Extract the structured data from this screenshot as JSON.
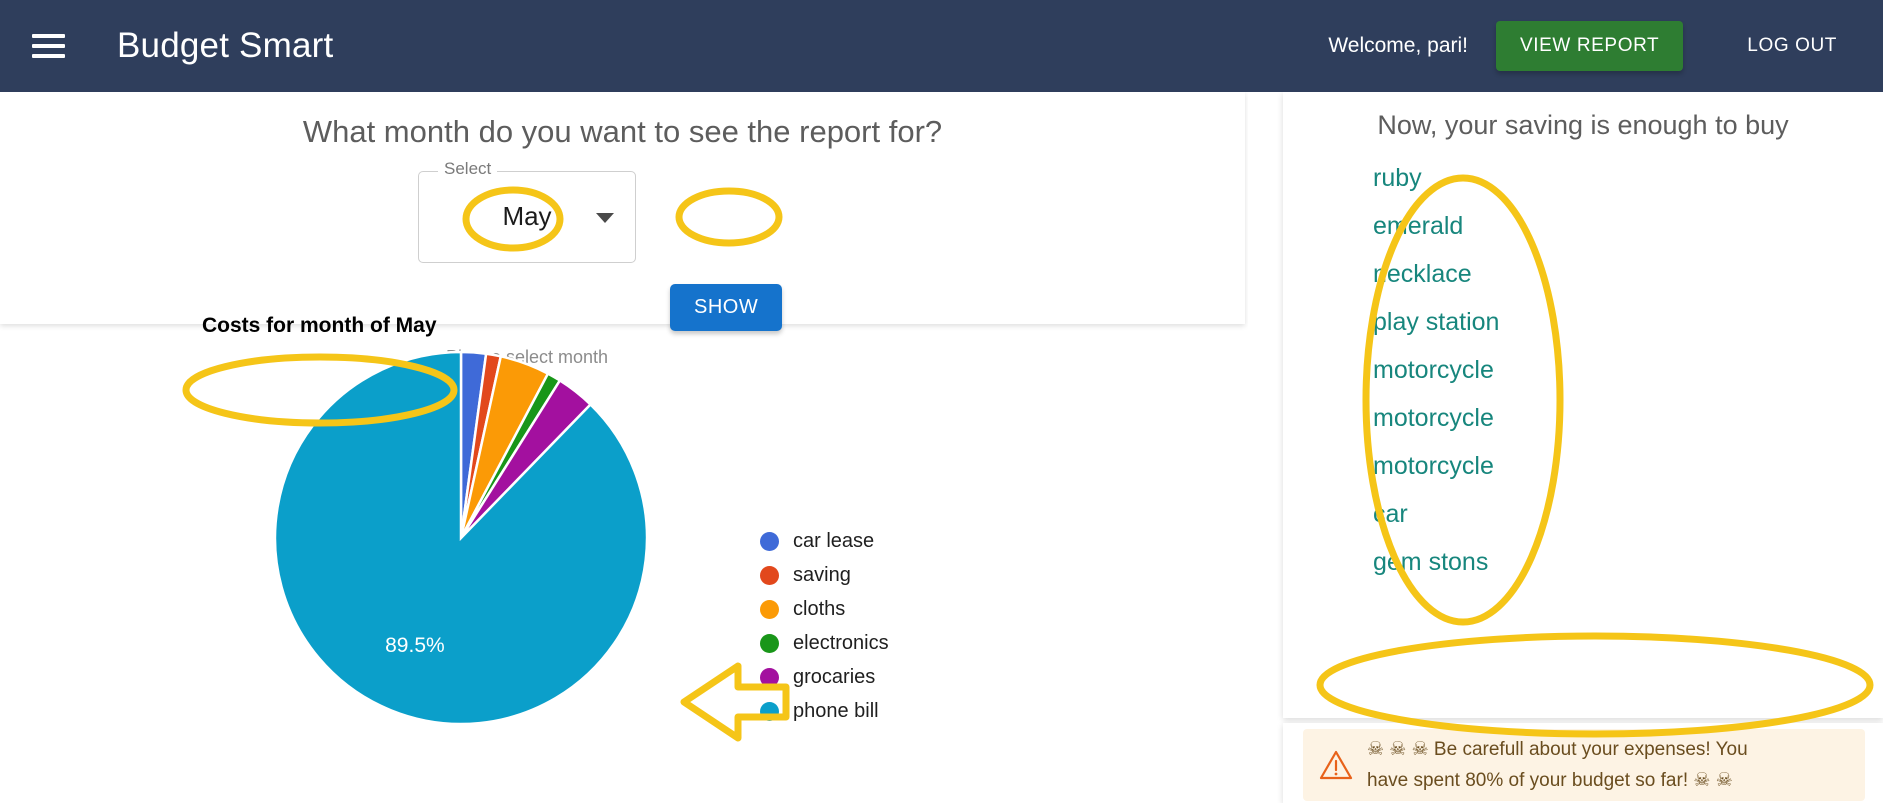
{
  "header": {
    "menu_icon": "hamburger-menu-icon",
    "title": "Budget Smart",
    "welcome": "Welcome, pari!",
    "view_report_label": "VIEW REPORT",
    "logout_label": "LOG OUT",
    "bar_color": "#2f3e5c",
    "view_report_color": "#2e7d32"
  },
  "main": {
    "question": "What month do you want to see the report for?",
    "select": {
      "legend": "Select",
      "value": "May",
      "helper": "Please select month",
      "caret_icon": "chevron-down-icon"
    },
    "show_button": {
      "label": "SHOW",
      "color": "#1573cc"
    }
  },
  "chart_data": {
    "type": "pie",
    "title": "Costs for month of May",
    "categories": [
      "car lease",
      "saving",
      "cloths",
      "electronics",
      "grocaries",
      "phone bill"
    ],
    "values": [
      2.2,
      1.3,
      4.4,
      1.2,
      3.4,
      89.5
    ],
    "colors": [
      "#3f6ad8",
      "#e2481c",
      "#fb9a06",
      "#199619",
      "#a3109f",
      "#0b9fca"
    ],
    "labels": [
      "",
      "",
      "",
      "",
      "",
      "89.5%"
    ],
    "legend_position": "right",
    "grid": false,
    "xlabel": "",
    "ylabel": ""
  },
  "saving": {
    "title": "Now, your saving is enough to buy",
    "items": [
      "ruby",
      "emerald",
      "necklace",
      "play station",
      "motorcycle",
      "motorcycle",
      "motorcycle",
      "car",
      "gem stons"
    ],
    "item_color": "#17867d"
  },
  "alert": {
    "icon": "warning-triangle-icon",
    "line1": "☠ ☠ ☠  Be carefull about your expenses! You",
    "line2": "have spent 80% of your budget so far! ☠ ☠",
    "background": "#fdf3e4"
  },
  "annotations": {
    "color": "#f5c518",
    "ellipse_select": "highlight-ellipse-month-value",
    "ellipse_show": "highlight-ellipse-show-button",
    "ellipse_chart_title": "highlight-ellipse-chart-title",
    "ellipse_saving_list": "highlight-ellipse-saving-list",
    "ellipse_alert": "highlight-ellipse-alert",
    "arrow": "highlight-arrow-left"
  }
}
